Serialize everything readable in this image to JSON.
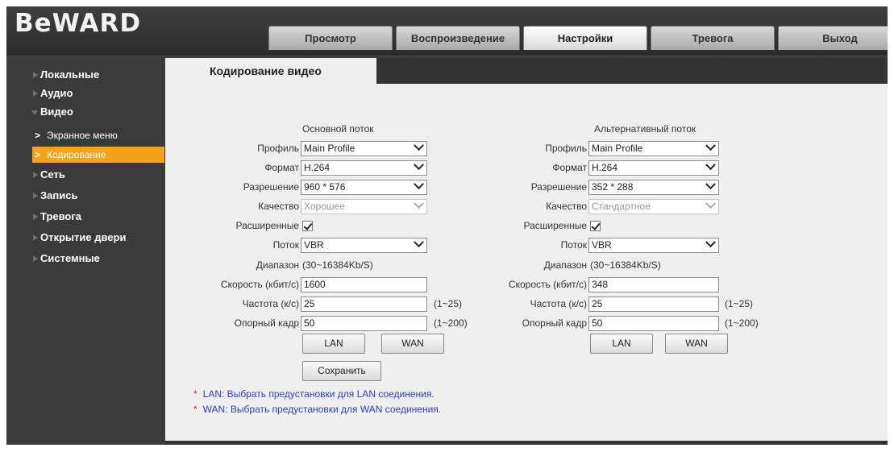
{
  "app": {
    "logo": "BeWARD"
  },
  "nav": {
    "tabs": [
      {
        "label": "Просмотр"
      },
      {
        "label": "Воспроизведение"
      },
      {
        "label": "Настройки"
      },
      {
        "label": "Тревога"
      },
      {
        "label": "Выход"
      }
    ],
    "active_index": 2
  },
  "sidebar": {
    "items": [
      {
        "label": "Локальные"
      },
      {
        "label": "Аудио"
      },
      {
        "label": "Видео"
      },
      {
        "label": "Экранное меню"
      },
      {
        "label": "Кодирование"
      },
      {
        "label": "Сеть"
      },
      {
        "label": "Запись"
      },
      {
        "label": "Тревога"
      },
      {
        "label": "Открытие двери"
      },
      {
        "label": "Системные"
      }
    ],
    "active_subitem": "Кодирование"
  },
  "page": {
    "tab_title": "Кодирование видео"
  },
  "labels": {
    "profile": "Профиль",
    "format": "Формат",
    "resolution": "Разрешение",
    "quality": "Качество",
    "advanced": "Расширенные",
    "stream": "Поток",
    "range": "Диапазон",
    "bitrate": "Скорость (кбит/с)",
    "fps": "Частота (к/с)",
    "keyframe": "Опорный кадр"
  },
  "main_stream": {
    "title": "Основной поток",
    "profile": "Main Profile",
    "format": "H.264",
    "resolution": "960 * 576",
    "quality": "Хорошее",
    "advanced_checked": true,
    "stream": "VBR",
    "range": "(30~16384Kb/S)",
    "bitrate": "1600",
    "fps": "25",
    "fps_hint": "(1~25)",
    "keyframe": "50",
    "keyframe_hint": "(1~200)",
    "lan_label": "LAN",
    "wan_label": "WAN"
  },
  "alt_stream": {
    "title": "Альтернативный поток",
    "profile": "Main Profile",
    "format": "H.264",
    "resolution": "352 * 288",
    "quality": "Стандартное",
    "advanced_checked": true,
    "stream": "VBR",
    "range": "(30~16384Kb/S)",
    "bitrate": "348",
    "fps": "25",
    "fps_hint": "(1~25)",
    "keyframe": "50",
    "keyframe_hint": "(1~200)",
    "lan_label": "LAN",
    "wan_label": "WAN"
  },
  "actions": {
    "save_label": "Сохранить"
  },
  "notes": {
    "star": "*",
    "lan": "LAN: Выбрать предустановки для LAN соединения.",
    "wan": "WAN: Выбрать предустановки для WAN соединения."
  },
  "colors": {
    "accent": "#f7a21b",
    "note_text": "#2a3fd3",
    "note_star": "#e0302a"
  }
}
